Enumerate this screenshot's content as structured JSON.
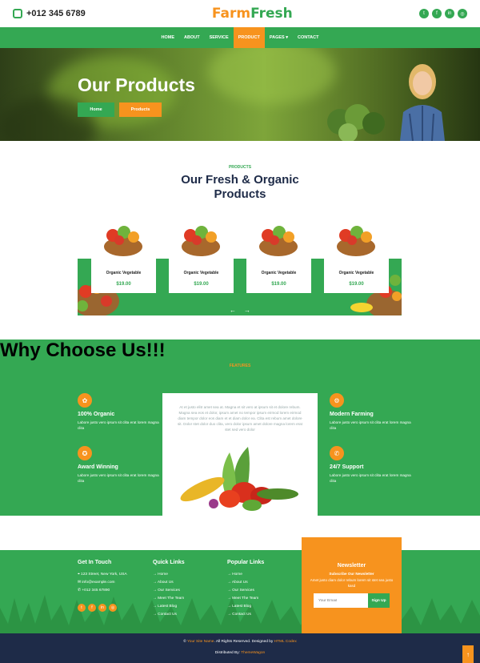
{
  "topbar": {
    "phone": "+012 345 6789",
    "logo_a": "Farm",
    "logo_b": "Fresh",
    "social_icons": [
      "twitter-icon",
      "facebook-icon",
      "linkedin-icon",
      "instagram-icon"
    ]
  },
  "nav": {
    "items": [
      "HOME",
      "ABOUT",
      "SERVICE",
      "PRODUCT",
      "PAGES ▾",
      "CONTACT"
    ],
    "active": "PRODUCT"
  },
  "hero": {
    "title": "Our Products",
    "btn_home": "Home",
    "btn_products": "Products"
  },
  "products": {
    "eyebrow": "PRODUCTS",
    "heading_l1": "Our Fresh & Organic",
    "heading_l2": "Products",
    "items": [
      {
        "name": "Organic Vegetable",
        "price": "$19.00"
      },
      {
        "name": "Organic Vegetable",
        "price": "$19.00"
      },
      {
        "name": "Organic Vegetable",
        "price": "$19.00"
      },
      {
        "name": "Organic Vegetable",
        "price": "$19.00"
      }
    ],
    "prev": "←",
    "next": "→"
  },
  "why": {
    "eyebrow": "FEATURES",
    "heading": "Why Choose Us!!!",
    "center_text": "At et justo elitr amet sea at. Magna et sit vero at ipsum sit et dolore rebum. Magna sea eos et dolor, ipsum amet no tempor ipsum eirmod lorem eirmod diam tempor dolor eos diam et et diam dolor ea. Clita est rebum amet dolore sit. Dolor stet dolor duo clita, vero dolor ipsum amet dolore magna lorem erat stet sed vero dolor",
    "features": [
      {
        "title": "100% Organic",
        "desc": "Labore justo vero ipsum sit clita erat lorem magna clita"
      },
      {
        "title": "Award Winning",
        "desc": "Labore justo vero ipsum sit clita erat lorem magna clita"
      },
      {
        "title": "Modern Farming",
        "desc": "Labore justo vero ipsum sit clita erat lorem magna clita"
      },
      {
        "title": "24/7 Support",
        "desc": "Labore justo vero ipsum sit clita erat lorem magna clita"
      }
    ]
  },
  "footer": {
    "touch": {
      "title": "Get In Touch",
      "address": "123 Street, New York, USA",
      "email": "info@example.com",
      "phone": "+012 345 67890"
    },
    "quick": {
      "title": "Quick Links",
      "links": [
        "Home",
        "About Us",
        "Our Services",
        "Meet The Team",
        "Latest Blog",
        "Contact Us"
      ]
    },
    "popular": {
      "title": "Popular Links",
      "links": [
        "Home",
        "About Us",
        "Our Services",
        "Meet The Team",
        "Latest Blog",
        "Contact Us"
      ]
    },
    "newsletter": {
      "title": "Newsletter",
      "subtitle": "Subscribe Our Newsletter",
      "desc": "Amet justo diam dolor rebum lorem sit stet sea justo kasd",
      "placeholder": "Your Email",
      "button": "Sign Up"
    }
  },
  "copyright": {
    "pre": "© ",
    "site": "Your Site Name",
    "mid": ". All Rights Reserved. Designed by ",
    "designer": "HTML Codex",
    "dist_pre": "Distributed By: ",
    "dist": "ThemeWagon"
  },
  "colors": {
    "green": "#34a853",
    "orange": "#f7931e",
    "navy": "#1e2b48"
  }
}
